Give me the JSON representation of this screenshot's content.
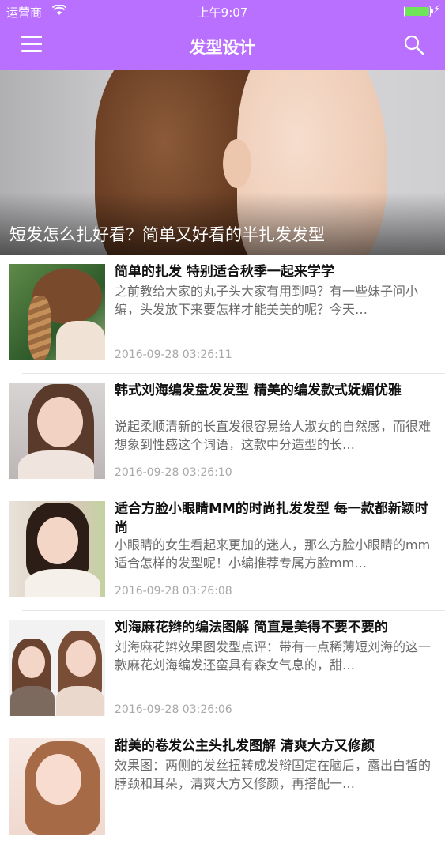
{
  "status_bar": {
    "carrier": "运营商",
    "time": "上午9:07"
  },
  "nav": {
    "title": "发型设计",
    "menu_icon": "menu-icon",
    "search_icon": "search-icon"
  },
  "banner": {
    "caption": "短发怎么扎好看？简单又好看的半扎发发型"
  },
  "colors": {
    "header": "#b970ff",
    "title_text": "#111111",
    "summary_text": "#6a6a6a",
    "date_text": "#a8a8a8"
  },
  "articles": [
    {
      "title": "简单的扎发 特别适合秋季一起来学学",
      "summary": "之前教给大家的丸子头大家有用到吗？有一些妹子问小编，头发放下来要怎样才能美美的呢？今天…",
      "date": "2016-09-28 03:26:11"
    },
    {
      "title": "韩式刘海编发盘发发型 精美的编发款式妩媚优雅",
      "summary": "说起柔顺清新的长直发很容易给人淑女的自然感，而很难想象到性感这个词语，这款中分造型的长…",
      "date": "2016-09-28 03:26:10"
    },
    {
      "title": "适合方脸小眼睛MM的时尚扎发发型 每一款都新颖时尚",
      "summary": "小眼睛的女生看起来更加的迷人，那么方脸小眼睛的mm适合怎样的发型呢！小编推荐专属方脸mm…",
      "date": "2016-09-28 03:26:08"
    },
    {
      "title": "刘海麻花辫的编法图解 简直是美得不要不要的",
      "summary": "刘海麻花辫效果图发型点评：带有一点稀薄短刘海的这一款麻花刘海编发还蛮具有森女气息的，甜…",
      "date": "2016-09-28 03:26:06"
    },
    {
      "title": "甜美的卷发公主头扎发图解 清爽大方又修颜",
      "summary": "效果图：两侧的发丝扭转成发辫固定在脑后，露出白皙的脖颈和耳朵，清爽大方又修颜，再搭配一…",
      "date": ""
    }
  ]
}
